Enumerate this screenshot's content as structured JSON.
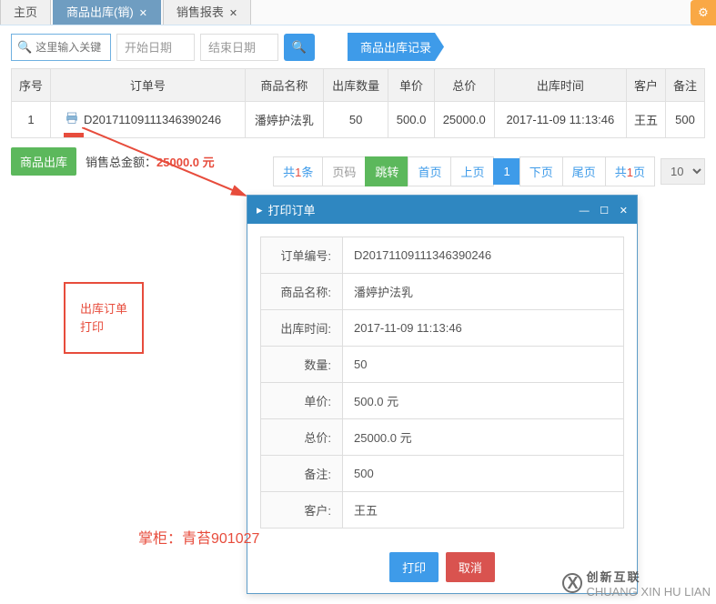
{
  "tabs": {
    "home": "主页",
    "outbound": "商品出库(销)",
    "report": "销售报表"
  },
  "toolbar": {
    "search_placeholder": "这里输入关键",
    "start_date": "开始日期",
    "end_date": "结束日期",
    "ribbon_label": "商品出库记录"
  },
  "table": {
    "headers": {
      "seq": "序号",
      "order_no": "订单号",
      "product": "商品名称",
      "qty": "出库数量",
      "price": "单价",
      "total": "总价",
      "time": "出库时间",
      "customer": "客户",
      "notes": "备注"
    },
    "rows": [
      {
        "seq": "1",
        "order_no": "D20171109111346390246",
        "product": "潘婷护法乳",
        "qty": "50",
        "price": "500.0",
        "total": "25000.0",
        "time": "2017-11-09 11:13:46",
        "customer": "王五",
        "notes": "500"
      }
    ]
  },
  "actions": {
    "outbound_btn": "商品出库",
    "total_label": "销售总金额：",
    "total_value": "25000.0 元"
  },
  "pager": {
    "count_prefix": "共",
    "count_num": "1",
    "count_suffix": "条",
    "page_no": "页码",
    "jump": "跳转",
    "first": "首页",
    "prev": "上页",
    "current": "1",
    "next": "下页",
    "last": "尾页",
    "pages_prefix": "共",
    "pages_num": "1",
    "pages_suffix": "页",
    "size": "10"
  },
  "callout": {
    "line1": "出库订单",
    "line2": "打印"
  },
  "dialog": {
    "title": "打印订单",
    "fields": {
      "order_no_lbl": "订单编号:",
      "order_no_val": "D20171109111346390246",
      "product_lbl": "商品名称:",
      "product_val": "潘婷护法乳",
      "time_lbl": "出库时间:",
      "time_val": "2017-11-09 11:13:46",
      "qty_lbl": "数量:",
      "qty_val": "50",
      "price_lbl": "单价:",
      "price_val": "500.0 元",
      "total_lbl": "总价:",
      "total_val": "25000.0 元",
      "notes_lbl": "备注:",
      "notes_val": "500",
      "customer_lbl": "客户:",
      "customer_val": "王五"
    },
    "buttons": {
      "print": "打印",
      "cancel": "取消"
    }
  },
  "footer_note": "掌柜：青苔901027",
  "watermark": {
    "cn": "创新互联",
    "en": "CHUANG XIN HU LIAN"
  }
}
